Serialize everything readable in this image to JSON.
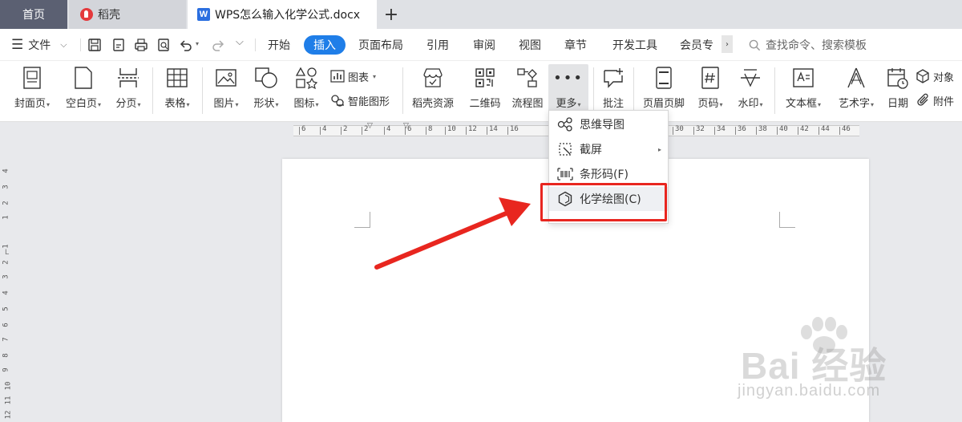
{
  "tabs": {
    "home": "首页",
    "daoke": "稻壳",
    "document": "WPS怎么输入化学公式.docx",
    "add": "+"
  },
  "menubar": {
    "menu_label": "文件",
    "tabs": [
      "开始",
      "插入",
      "页面布局",
      "引用",
      "审阅",
      "视图",
      "章节",
      "开发工具",
      "会员专"
    ],
    "active_tab": "插入",
    "overflow": "›",
    "search_placeholder": "查找命令、搜索模板"
  },
  "ribbon": {
    "cover": "封面页",
    "blank": "空白页",
    "page_break": "分页",
    "table": "表格",
    "picture": "图片",
    "shape": "形状",
    "icon": "图标",
    "chart": "图表",
    "smart_art": "智能图形",
    "daoke_res": "稻壳资源",
    "qrcode": "二维码",
    "flowchart": "流程图",
    "more": "更多",
    "comment": "批注",
    "header_footer": "页眉页脚",
    "page_number": "页码",
    "watermark": "水印",
    "textbox": "文本框",
    "wordart": "艺术字",
    "date": "日期",
    "object": "对象",
    "attachment": "附件"
  },
  "dropdown": {
    "items": [
      "思维导图",
      "截屏",
      "条形码(F)",
      "化学绘图(C)"
    ]
  },
  "ruler": {
    "top": [
      "6",
      "4",
      "2",
      "2",
      "4",
      "6",
      "8",
      "10",
      "12",
      "14",
      "16",
      "30",
      "32",
      "34",
      "36",
      "38",
      "40",
      "42",
      "44",
      "46"
    ],
    "left": [
      "4",
      "3",
      "2",
      "1",
      "1",
      "2",
      "3",
      "4",
      "5",
      "6",
      "7",
      "8",
      "9",
      "10",
      "11",
      "12"
    ],
    "corner": "L"
  },
  "watermark": {
    "brand": "Bai 经验",
    "url": "jingyan.baidu.com"
  },
  "colors": {
    "accent": "#1f7ee8",
    "highlight_red": "#e8261f",
    "home_tab": "#5b6072"
  }
}
